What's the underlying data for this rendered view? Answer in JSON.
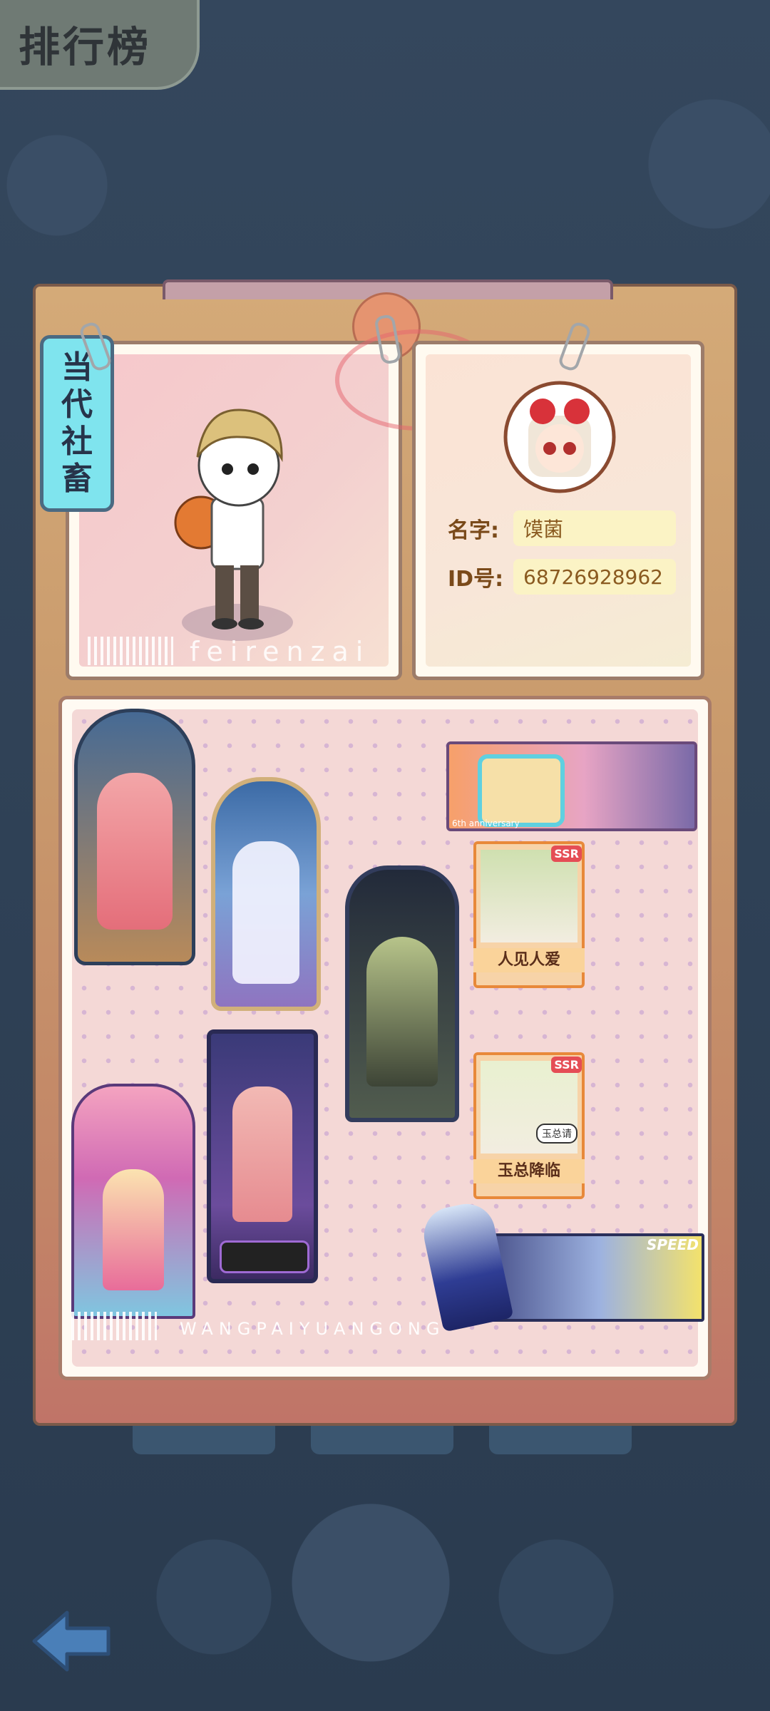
{
  "header": {
    "title": "排行榜"
  },
  "profile": {
    "title_tag": [
      "当",
      "代",
      "社",
      "畜"
    ],
    "name_label": "名字:",
    "name_value": "馍菌",
    "id_label": "ID号:",
    "id_value": "68726928962",
    "watermark": "feirenzai"
  },
  "collection": {
    "watermark": "WANGPAIYUANGONG",
    "cards": [
      {
        "name": "card-rose-lady"
      },
      {
        "name": "card-blue-princess"
      },
      {
        "name": "card-dark-gothic"
      },
      {
        "name": "card-anniversary-banner",
        "text": "6th anniversary"
      },
      {
        "name": "card-ssr-1",
        "rank": "SSR",
        "label": "人见人爱"
      },
      {
        "name": "card-ssr-2",
        "rank": "SSR",
        "label": "玉总降临",
        "bubble": "玉总请"
      },
      {
        "name": "card-idol-stage"
      },
      {
        "name": "card-shopping-tower"
      },
      {
        "name": "card-speed-banner",
        "text": "SPEED"
      }
    ]
  },
  "colors": {
    "accent": "#7fe4ee",
    "folder": "#d4aa78",
    "background": "#2b3d52"
  }
}
